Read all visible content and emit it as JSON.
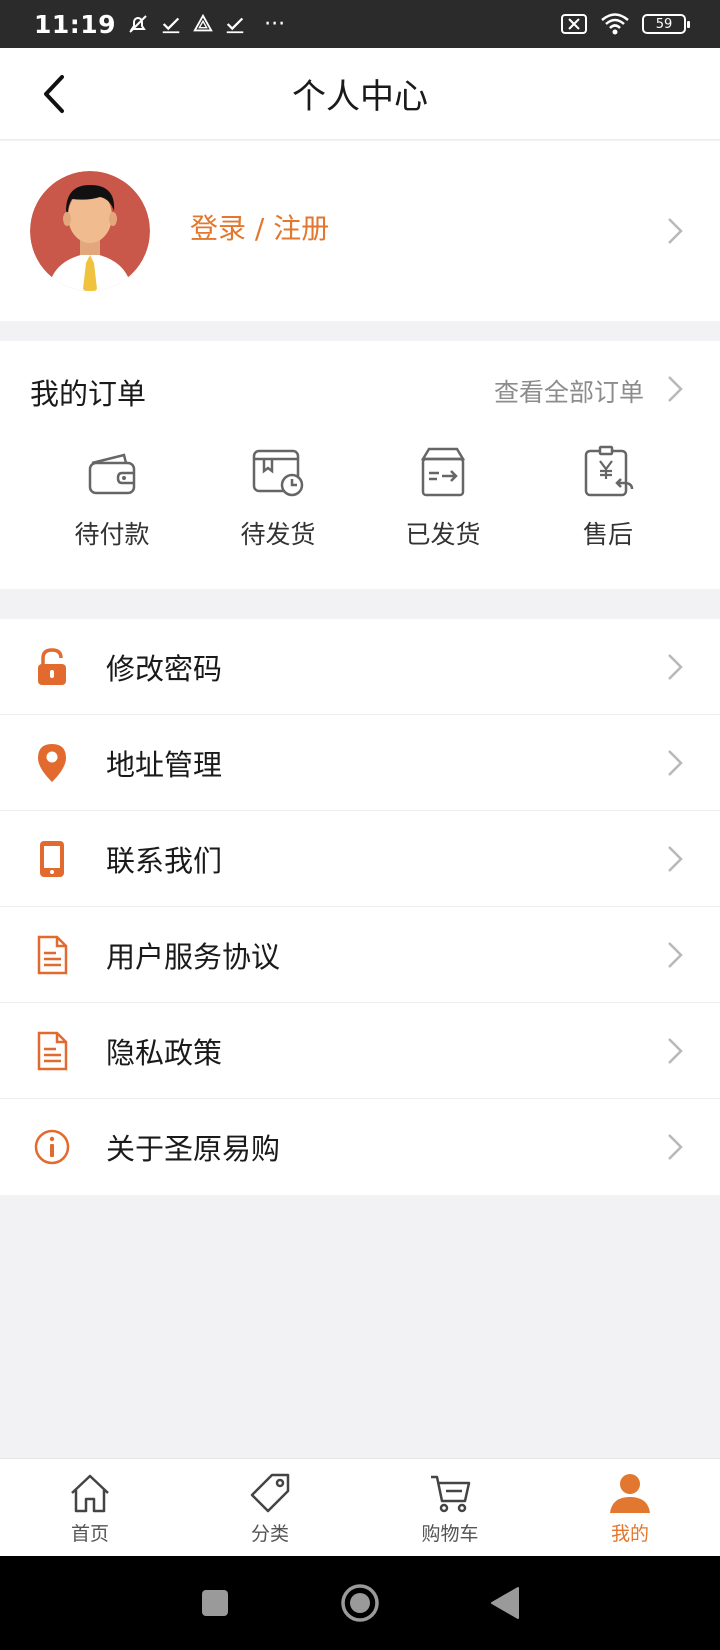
{
  "status_bar": {
    "time": "11:19",
    "more": "···",
    "battery": "59"
  },
  "header": {
    "title": "个人中心"
  },
  "profile": {
    "login_label": "登录 / 注册"
  },
  "orders": {
    "title": "我的订单",
    "view_all": "查看全部订单",
    "items": [
      {
        "label": "待付款",
        "icon": "wallet-icon"
      },
      {
        "label": "待发货",
        "icon": "schedule-box-icon"
      },
      {
        "label": "已发货",
        "icon": "box-arrow-icon"
      },
      {
        "label": "售后",
        "icon": "refund-icon"
      }
    ]
  },
  "menu": {
    "items": [
      {
        "label": "修改密码",
        "icon": "lock-icon"
      },
      {
        "label": "地址管理",
        "icon": "location-pin-icon"
      },
      {
        "label": "联系我们",
        "icon": "phone-icon"
      },
      {
        "label": "用户服务协议",
        "icon": "document-icon"
      },
      {
        "label": "隐私政策",
        "icon": "document-icon"
      },
      {
        "label": "关于圣原易购",
        "icon": "info-icon"
      }
    ]
  },
  "tabbar": {
    "items": [
      {
        "label": "首页",
        "icon": "home-icon"
      },
      {
        "label": "分类",
        "icon": "tag-icon"
      },
      {
        "label": "购物车",
        "icon": "cart-icon"
      },
      {
        "label": "我的",
        "icon": "user-icon",
        "active": true
      }
    ]
  },
  "colors": {
    "accent": "#e2772f",
    "background": "#f2f2f5"
  }
}
